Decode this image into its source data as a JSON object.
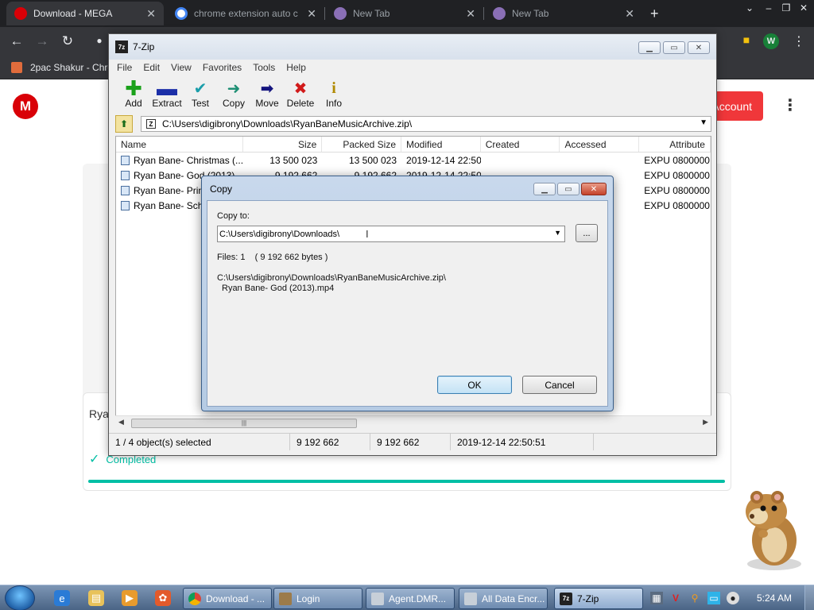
{
  "browser": {
    "tabs": [
      {
        "label": "Download - MEGA",
        "active": true
      },
      {
        "label": "chrome extension auto c"
      },
      {
        "label": "New Tab"
      },
      {
        "label": "New Tab"
      }
    ],
    "new_tab_glyph": "+",
    "profile_initial": "W",
    "bookmark": "2pac Shakur - Chro"
  },
  "mega": {
    "logo": "M",
    "account_button": "Account",
    "file_name_partial": "Rya",
    "status": "Completed",
    "accent_color": "#00bfa5",
    "brand_color": "#d90007"
  },
  "zip": {
    "title": "7-Zip",
    "app_icon_text": "7z",
    "menu": [
      "File",
      "Edit",
      "View",
      "Favorites",
      "Tools",
      "Help"
    ],
    "toolbar": {
      "add": "Add",
      "extract": "Extract",
      "test": "Test",
      "copy": "Copy",
      "move": "Move",
      "delete": "Delete",
      "info": "Info"
    },
    "address": "C:\\Users\\digibrony\\Downloads\\RyanBaneMusicArchive.zip\\",
    "columns": {
      "name": "Name",
      "size": "Size",
      "packed": "Packed Size",
      "modified": "Modified",
      "created": "Created",
      "accessed": "Accessed",
      "attributes": "Attribute"
    },
    "rows": [
      {
        "name": "Ryan Bane- Christmas (...",
        "size": "13 500 023",
        "packed": "13 500 023",
        "modified": "2019-12-14 22:50",
        "attr": "EXPU 0800000"
      },
      {
        "name": "Ryan Bane- God (2013)",
        "size": "9 192 662",
        "packed": "9 192 662",
        "modified": "2019-12-14 22:50",
        "attr": "EXPU 0800000"
      },
      {
        "name": "Ryan Bane- Prin",
        "size": "",
        "packed": "",
        "modified": "",
        "attr": "EXPU 0800000"
      },
      {
        "name": "Ryan Bane- Scho",
        "size": "",
        "packed": "",
        "modified": "",
        "attr": "EXPU 0800000"
      }
    ],
    "status": {
      "selected": "1 / 4 object(s) selected",
      "size": "9 192 662",
      "packed": "9 192 662",
      "modified": "2019-12-14 22:50:51"
    }
  },
  "copy_dialog": {
    "title": "Copy",
    "copy_to_label": "Copy to:",
    "destination": "C:\\Users\\digibrony\\Downloads\\",
    "browse_label": "...",
    "files_info": "Files: 1    ( 9 192 662 bytes )",
    "source_path": "C:\\Users\\digibrony\\Downloads\\RyanBaneMusicArchive.zip\\",
    "source_file": "Ryan Bane- God (2013).mp4",
    "ok": "OK",
    "cancel": "Cancel"
  },
  "taskbar": {
    "buttons": [
      "Download - ...",
      "Login",
      "Agent.DMR...",
      "All Data Encr...",
      "7-Zip"
    ],
    "clock": "5:24 AM"
  }
}
